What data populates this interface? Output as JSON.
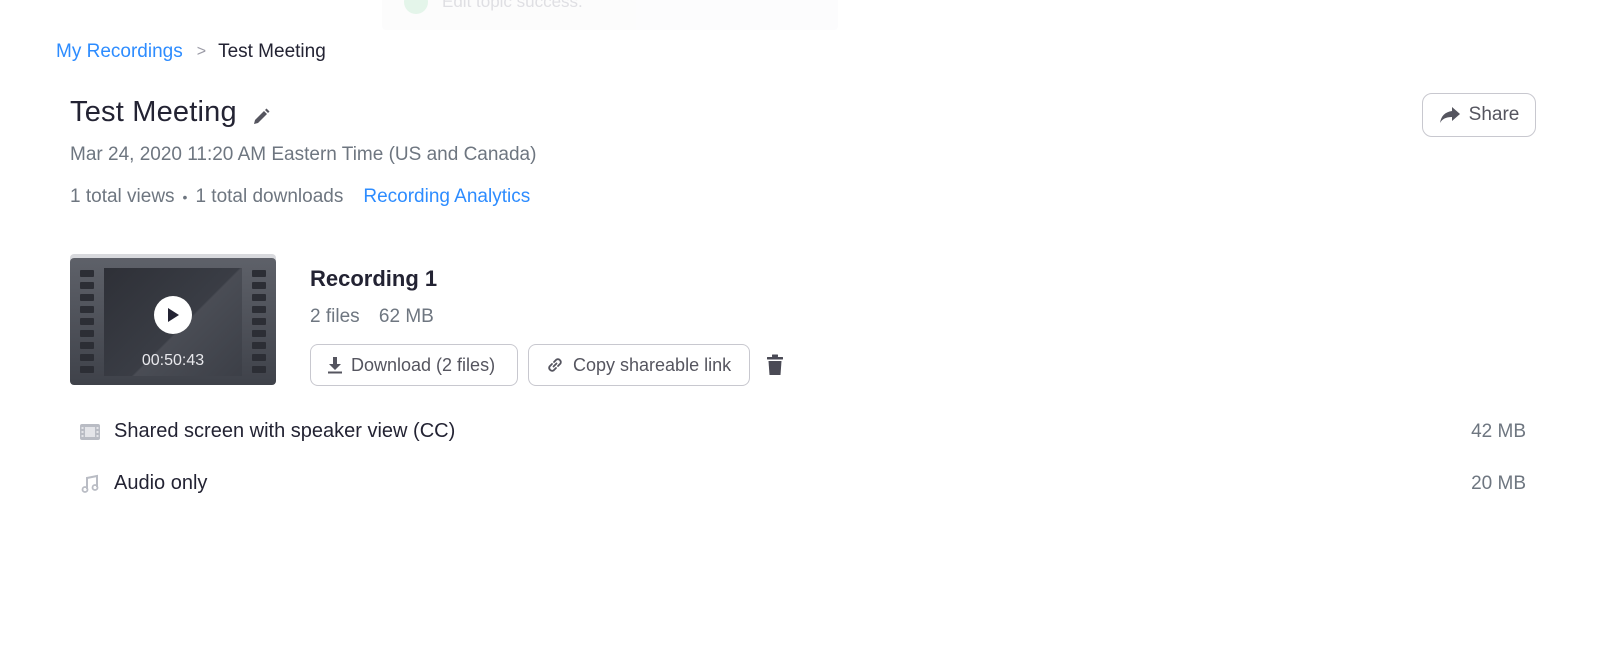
{
  "toast": {
    "message": "Edit topic success."
  },
  "breadcrumb": {
    "parent": "My Recordings",
    "separator": ">",
    "current": "Test Meeting"
  },
  "meeting": {
    "title": "Test Meeting",
    "datetime": "Mar 24, 2020 11:20 AM Eastern Time (US and Canada)",
    "views": "1 total views",
    "dot": "•",
    "downloads": "1 total downloads",
    "analytics_link": "Recording Analytics"
  },
  "share_button": {
    "label": "Share",
    "icon": "share-arrow-icon"
  },
  "recording": {
    "title": "Recording 1",
    "files_count": "2 files",
    "size": "62 MB",
    "duration": "00:50:43",
    "download_label": "Download (2 files)",
    "copy_label": "Copy shareable link"
  },
  "files": [
    {
      "name": "Shared screen with speaker view (CC)",
      "size": "42 MB",
      "icon": "video-file-icon"
    },
    {
      "name": "Audio only",
      "size": "20 MB",
      "icon": "music-note-icon"
    }
  ],
  "colors": {
    "link": "#2d8cff",
    "text": "#232333",
    "muted": "#6e7680",
    "border": "#c8c8cf"
  }
}
